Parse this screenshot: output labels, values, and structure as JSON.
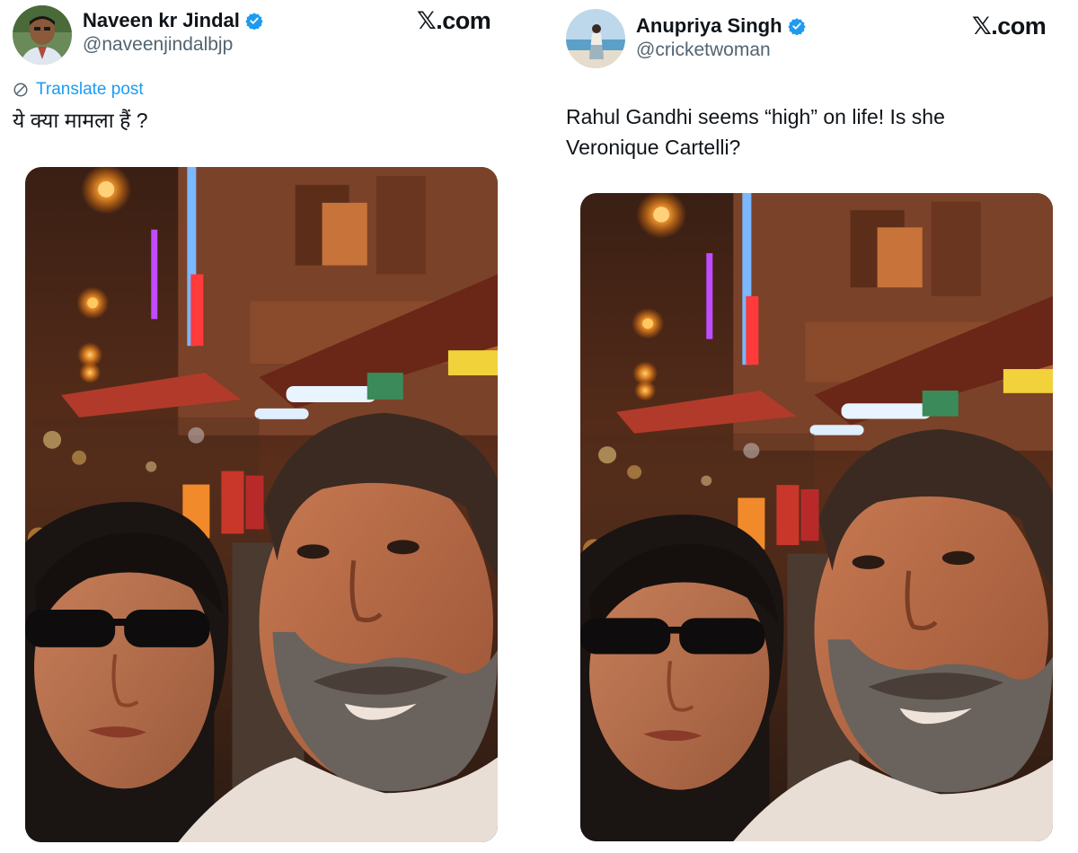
{
  "posts": [
    {
      "author": {
        "name": "Naveen kr Jindal",
        "handle": "@naveenjindalbjp",
        "verified": true,
        "avatar_icon": "person-avatar-icon"
      },
      "brand": "𝕏.com",
      "translate_label": "Translate post",
      "text": "ये क्या मामला हैं ?"
    },
    {
      "author": {
        "name": "Anupriya Singh",
        "handle": "@cricketwoman",
        "verified": true,
        "avatar_icon": "beach-avatar-icon"
      },
      "brand": "𝕏.com",
      "text_lines": [
        "Rahul Gandhi seems “high” on life! Is she",
        "Veronique Cartelli?"
      ]
    }
  ],
  "colors": {
    "accent": "#1d9bf0",
    "text": "#0f1419",
    "muted": "#536471"
  }
}
